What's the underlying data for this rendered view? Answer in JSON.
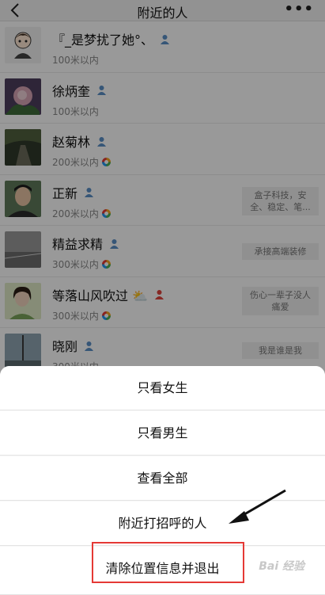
{
  "nav": {
    "back_icon": "chevron-left-icon",
    "title": "附近的人",
    "more_icon": "more-dots-icon"
  },
  "people": [
    {
      "name": "『_是梦扰了她°、",
      "distance": "100米以内",
      "gender_icon": "male-person-icon",
      "ring": false,
      "signature": ""
    },
    {
      "name": "徐炳奎",
      "distance": "100米以内",
      "gender_icon": "male-person-icon",
      "ring": false,
      "signature": ""
    },
    {
      "name": "赵菊林",
      "distance": "200米以内",
      "gender_icon": "male-person-icon",
      "ring": true,
      "signature": ""
    },
    {
      "name": "正新",
      "distance": "200米以内",
      "gender_icon": "male-person-icon",
      "ring": true,
      "signature": "盒子科技，安全、稳定、笔..."
    },
    {
      "name": "精益求精",
      "distance": "300米以内",
      "gender_icon": "male-person-icon",
      "ring": true,
      "signature": "承接高端装修"
    },
    {
      "name": "等落山风吹过 ⛅",
      "distance": "300米以内",
      "gender_icon": "female-person-icon",
      "ring": true,
      "signature": "伤心一辈子没人痛爱"
    },
    {
      "name": "晓刚",
      "distance": "300米以内",
      "gender_icon": "male-person-icon",
      "ring": false,
      "signature": "我是谁是我"
    }
  ],
  "sheet": {
    "items": [
      "只看女生",
      "只看男生",
      "查看全部",
      "附近打招呼的人",
      "清除位置信息并退出"
    ]
  },
  "watermark": "Bai 经验",
  "colors": {
    "male": "#5b8fc7",
    "female": "#e0443c",
    "highlight": "#e53935"
  }
}
